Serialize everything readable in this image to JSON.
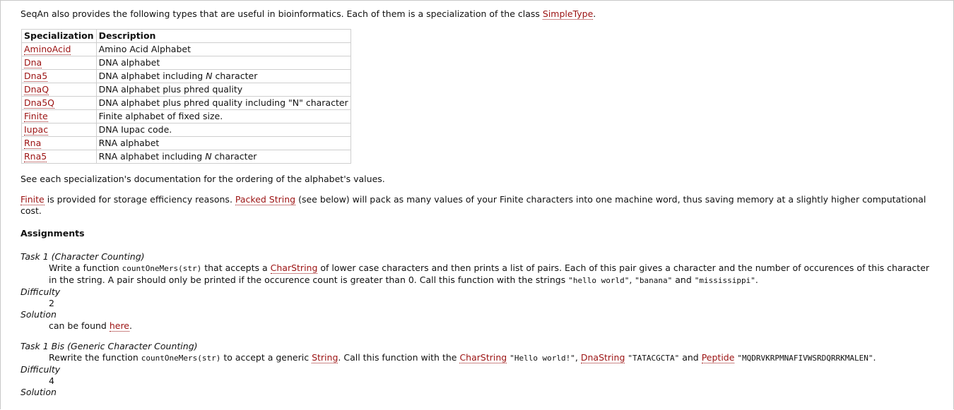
{
  "intro": {
    "text": "SeqAn also provides the following types that are useful in bioinformatics. Each of them is a specialization of the class ",
    "link": "SimpleType",
    "end": "."
  },
  "table": {
    "headers": [
      "Specialization",
      "Description"
    ],
    "rows": [
      {
        "name": "AminoAcid",
        "desc": "Amino Acid Alphabet"
      },
      {
        "name": "Dna",
        "desc": "DNA alphabet"
      },
      {
        "name": "Dna5",
        "desc_pre": "DNA alphabet including ",
        "desc_em": "N",
        "desc_post": " character"
      },
      {
        "name": "DnaQ",
        "desc": "DNA alphabet plus phred quality"
      },
      {
        "name": "Dna5Q",
        "desc": "DNA alphabet plus phred quality including \"N\" character"
      },
      {
        "name": "Finite",
        "desc": "Finite alphabet of fixed size."
      },
      {
        "name": "Iupac",
        "desc": "DNA Iupac code."
      },
      {
        "name": "Rna",
        "desc": "RNA alphabet"
      },
      {
        "name": "Rna5",
        "desc_pre": "RNA alphabet including ",
        "desc_em": "N",
        "desc_post": " character"
      }
    ]
  },
  "see_each": "See each specialization's documentation for the ordering of the alphabet's values.",
  "finite_para": {
    "link1": "Finite",
    "t1": " is provided for storage efficiency reasons. ",
    "link2": "Packed String",
    "t2": " (see below) will pack as many values of your Finite characters into one machine word, thus saving memory at a slightly higher computational cost."
  },
  "assignments_heading": "Assignments",
  "task1": {
    "title": "Task 1 (Character Counting)",
    "t1": "Write a function ",
    "code1": "countOneMers(str)",
    "t2": " that accepts a ",
    "link1": "CharString",
    "t3": " of lower case characters and then prints a list of pairs. Each of this pair gives a character and the number of occurences of this character in the string. A pair should only be printed if the occurence count is greater than 0. Call this function with the strings ",
    "code2": "\"hello world\"",
    "t4": ", ",
    "code3": "\"banana\"",
    "t5": " and ",
    "code4": "\"mississippi\"",
    "t6": ".",
    "difficulty_label": "Difficulty",
    "difficulty": "2",
    "solution_label": "Solution",
    "solution_pre": "can be found ",
    "solution_link": "here",
    "solution_post": "."
  },
  "task1b": {
    "title": "Task 1 Bis (Generic Character Counting)",
    "t1": "Rewrite the function ",
    "code1": "countOneMers(str)",
    "t2": " to accept a generic ",
    "link1": "String",
    "t3": ". Call this function with the ",
    "link2": "CharString",
    "t4": " ",
    "code2": "\"Hello world!\"",
    "t5": ", ",
    "link3": "DnaString",
    "t6": " ",
    "code3": "\"TATACGCTA\"",
    "t7": " and ",
    "link4": "Peptide",
    "t8": " ",
    "code4": "\"MQDRVKRPMNAFIVWSRDQRRKMALEN\"",
    "t9": ".",
    "difficulty_label": "Difficulty",
    "difficulty": "4",
    "solution_label": "Solution"
  }
}
